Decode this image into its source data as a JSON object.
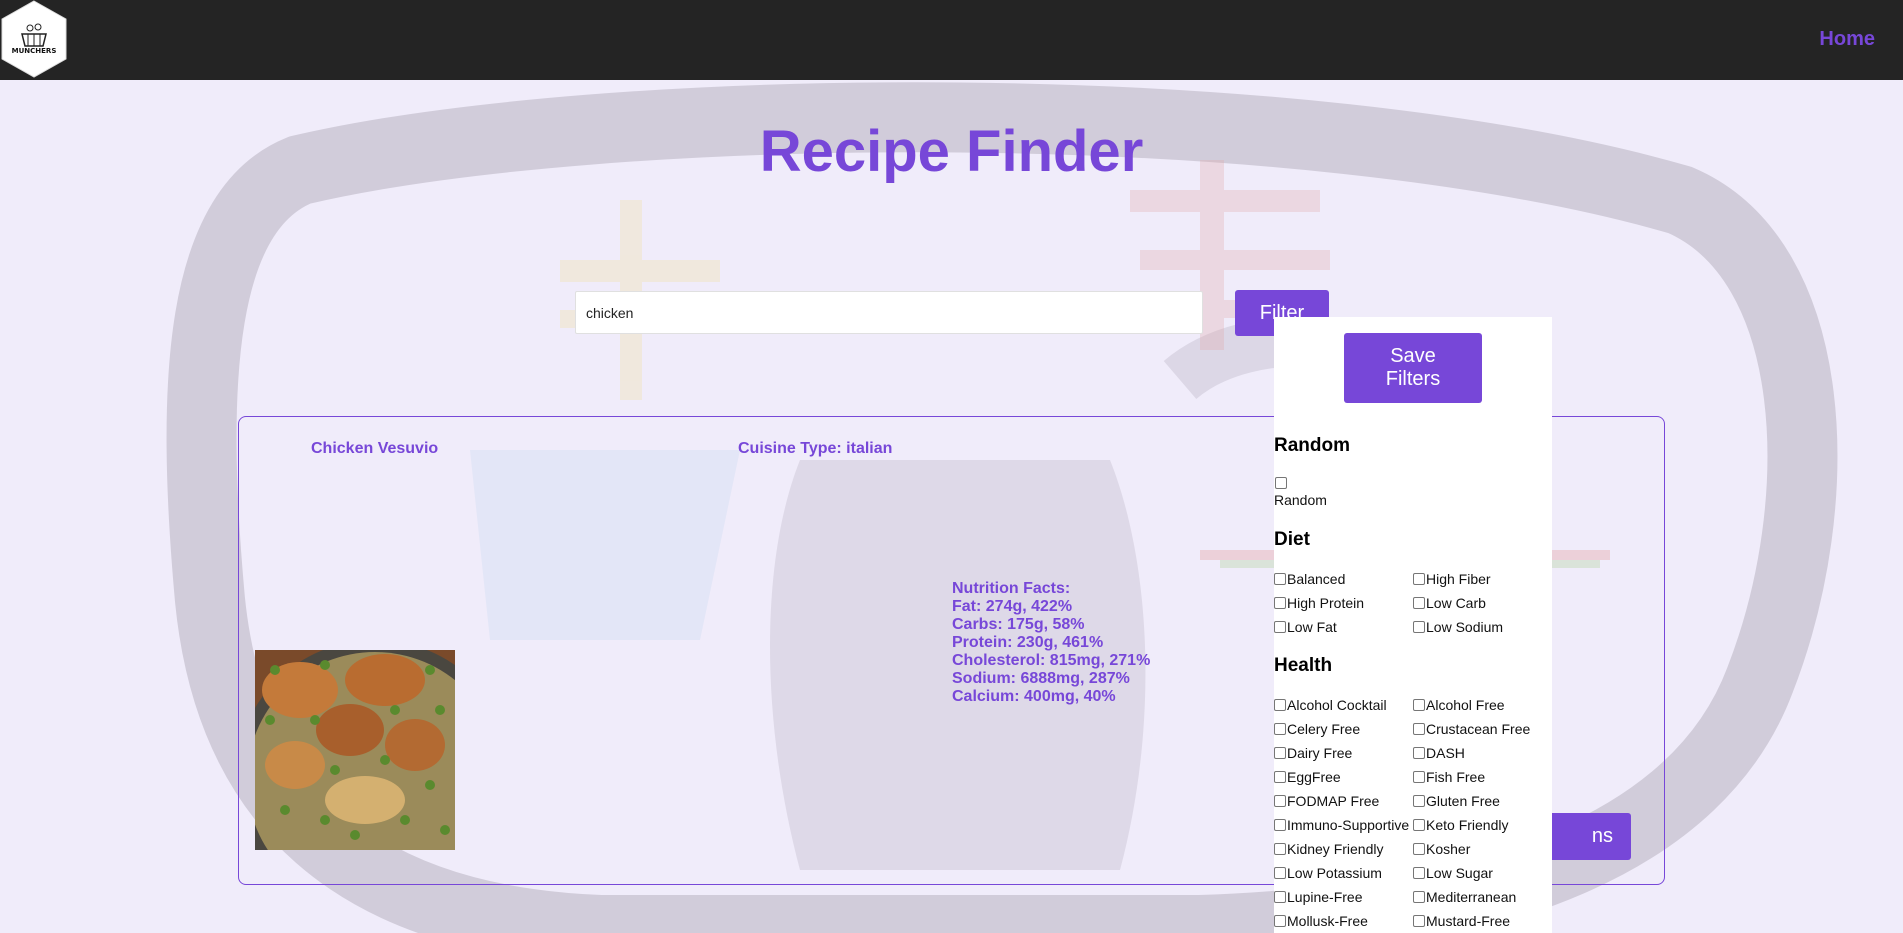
{
  "nav": {
    "logo_text": "MUNCHERS",
    "home_label": "Home"
  },
  "page": {
    "title": "Recipe Finder"
  },
  "search": {
    "value": "chicken",
    "filter_label": "Filter"
  },
  "recipe": {
    "name": "Chicken Vesuvio",
    "cuisine": "Cuisine Type: italian",
    "nutrition": [
      "Nutrition Facts:",
      "Fat: 274g, 422%",
      "Carbs: 175g, 58%",
      "Protein: 230g, 461%",
      "Cholesterol: 815mg, 271%",
      "Sodium: 6888mg, 287%",
      "Calcium: 400mg, 40%"
    ],
    "more_button_visible_text": "ns"
  },
  "filters": {
    "save_label": "Save Filters",
    "random": {
      "title": "Random",
      "label": "Random"
    },
    "diet": {
      "title": "Diet",
      "options": [
        "Balanced",
        "High Fiber",
        "High Protein",
        "Low Carb",
        "Low Fat",
        "Low Sodium"
      ]
    },
    "health": {
      "title": "Health",
      "options": [
        "Alcohol Cocktail",
        "Alcohol Free",
        "Celery Free",
        "Crustacean Free",
        "Dairy Free",
        "DASH",
        "EggFree",
        "Fish Free",
        "FODMAP Free",
        "Gluten Free",
        "Immuno-Supportive",
        "Keto Friendly",
        "Kidney Friendly",
        "Kosher",
        "Low Potassium",
        "Low Sugar",
        "Lupine-Free",
        "Mediterranean",
        "Mollusk-Free",
        "Mustard-Free"
      ]
    }
  },
  "colors": {
    "accent": "#7747d8",
    "navbar": "#242424",
    "background": "#f0ecfa"
  }
}
